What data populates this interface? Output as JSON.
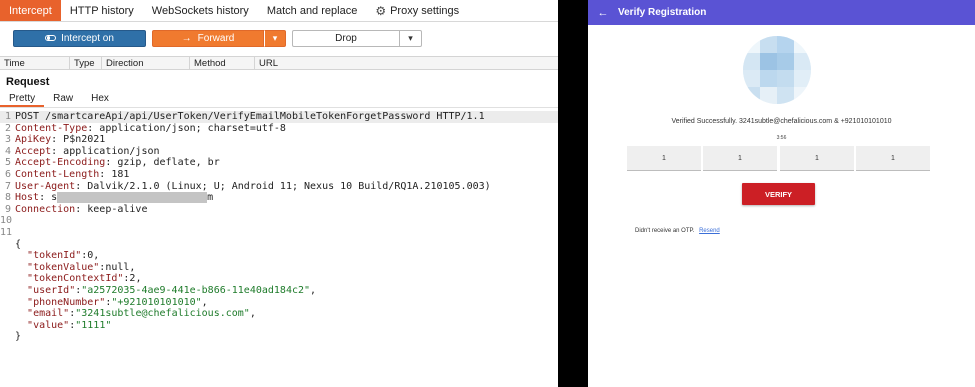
{
  "proxy": {
    "tabs": [
      {
        "label": "Intercept"
      },
      {
        "label": "HTTP history"
      },
      {
        "label": "WebSockets history"
      },
      {
        "label": "Match and replace"
      },
      {
        "label": "Proxy settings"
      }
    ],
    "toolbar": {
      "intercept_label": "Intercept on",
      "forward_label": "Forward",
      "drop_label": "Drop"
    },
    "columns": [
      "Time",
      "Type",
      "Direction",
      "Method",
      "URL"
    ],
    "request_title": "Request",
    "subtabs": [
      "Pretty",
      "Raw",
      "Hex"
    ],
    "request_lines": {
      "l1": "POST /smartcareApi/api/UserToken/VerifyEmailMobileTokenForgetPassword HTTP/1.1",
      "h2k": "Content-Type",
      "h2v": " application/json; charset=utf-8",
      "h3k": "ApiKey",
      "h3v": " P$n2021",
      "h4k": "Accept",
      "h4v": " application/json",
      "h5k": "Accept-Encoding",
      "h5v": " gzip, deflate, br",
      "h6k": "Content-Length",
      "h6v": " 181",
      "h7k": "User-Agent",
      "h7v": " Dalvik/2.1.0 (Linux; U; Android 11; Nexus 10 Build/RQ1A.210105.003)",
      "h8k": "Host",
      "h8a": " s",
      "h8b": "m",
      "h9k": "Connection",
      "h9v": " keep-alive",
      "open": "{",
      "close": "}"
    },
    "json_body": {
      "k1": "\"tokenId\"",
      "v1": "0",
      "s1": ",",
      "k2": "\"tokenValue\"",
      "v2": "null",
      "s2": ",",
      "k3": "\"tokenContextId\"",
      "v3": "2",
      "s3": ",",
      "k4": "\"userId\"",
      "v4": "\"a2572035-4ae9-441e-b866-11e40ad184c2\"",
      "s4": ",",
      "k5": "\"phoneNumber\"",
      "v5": "\"+921010101010\"",
      "s5": ",",
      "k6": "\"email\"",
      "v6": "\"3241subtle@chefalicious.com\"",
      "s6": ",",
      "k7": "\"value\"",
      "v7": "\"1111\""
    },
    "line_numbers": [
      "1",
      "2",
      "3",
      "4",
      "5",
      "6",
      "7",
      "8",
      "9",
      "10",
      "11"
    ]
  },
  "app": {
    "title": "Verify Registration",
    "status_text": "Verified Successfully. 3241subtle@chefalicious.com & +921010101010",
    "timer": "3:56",
    "otp_digits": [
      "1",
      "1",
      "1",
      "1"
    ],
    "verify_label": "VERIFY",
    "resend_prompt": "Didn't receive an OTP.",
    "resend_link": "Resend"
  },
  "colors": {
    "accent_orange": "#e8622c",
    "intercept_blue": "#2f70a8",
    "appbar_purple": "#5a53d4",
    "verify_red": "#cc1f25"
  }
}
